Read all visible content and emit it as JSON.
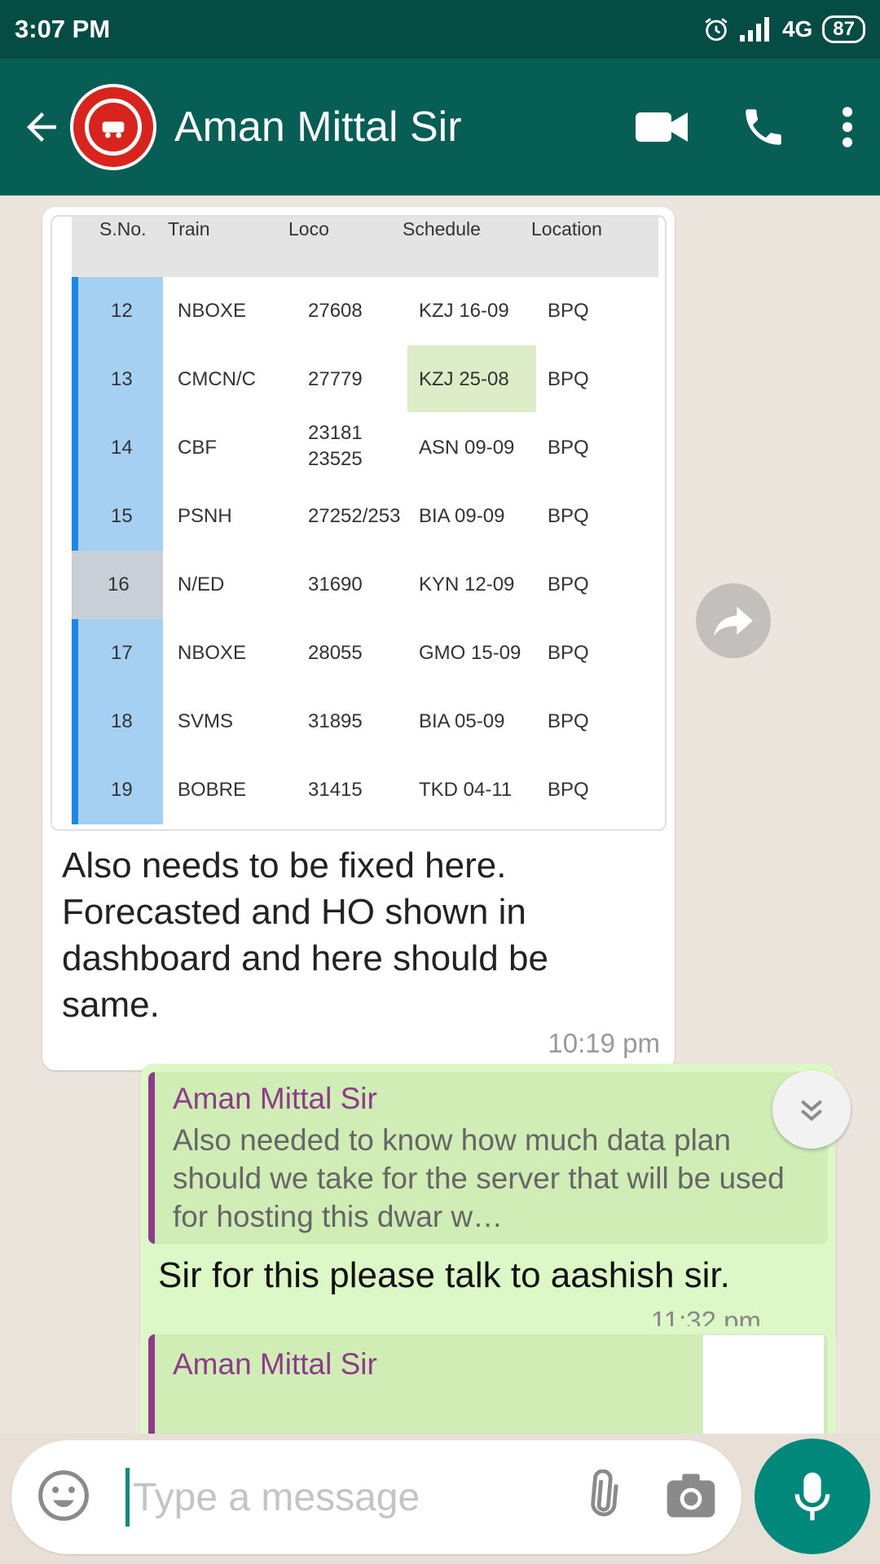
{
  "status_bar": {
    "time": "3:07 PM",
    "network": "4G",
    "battery": "87"
  },
  "header": {
    "contact_name": "Aman Mittal Sir"
  },
  "table": {
    "headers": [
      "S.No.",
      "Train",
      "Loco",
      "Schedule",
      "Location"
    ],
    "rows": [
      {
        "sno": "12",
        "train": "NBOXE",
        "loco": "27608",
        "schedule": "KZJ 16-09",
        "location": "BPQ"
      },
      {
        "sno": "13",
        "train": "CMCN/C",
        "loco": "27779",
        "schedule": "KZJ 25-08",
        "location": "BPQ"
      },
      {
        "sno": "14",
        "train": "CBF",
        "loco": "23181",
        "loco2": "23525",
        "schedule": "ASN 09-09",
        "location": "BPQ"
      },
      {
        "sno": "15",
        "train": "PSNH",
        "loco": "27252/253",
        "schedule": "BIA 09-09",
        "location": "BPQ"
      },
      {
        "sno": "16",
        "train": "N/ED",
        "loco": "31690",
        "schedule": "KYN 12-09",
        "location": "BPQ"
      },
      {
        "sno": "17",
        "train": "NBOXE",
        "loco": "28055",
        "schedule": "GMO 15-09",
        "location": "BPQ"
      },
      {
        "sno": "18",
        "train": "SVMS",
        "loco": "31895",
        "schedule": "BIA 05-09",
        "location": "BPQ"
      },
      {
        "sno": "19",
        "train": "BOBRE",
        "loco": "31415",
        "schedule": "TKD 04-11",
        "location": "BPQ"
      }
    ]
  },
  "messages": {
    "incoming_text": "Also needs to be fixed here. Forecasted and HO shown in dashboard and here should be same.",
    "incoming_time": "10:19 pm",
    "reply_quote_name": "Aman Mittal Sir",
    "reply_quote_text": "Also needed to know how much data plan should we take for the server that will be used for hosting this dwar w…",
    "outgoing_text": "Sir for this please talk to aashish sir.",
    "outgoing_time": "11:32 pm",
    "next_quote_name": "Aman Mittal Sir"
  },
  "input": {
    "placeholder": "Type a message"
  },
  "icons": [
    "back-arrow-icon",
    "video-call-icon",
    "voice-call-icon",
    "more-options-icon",
    "forward-icon",
    "scroll-down-icon",
    "emoji-icon",
    "attach-icon",
    "camera-icon",
    "mic-icon",
    "alarm-icon",
    "signal-icon"
  ],
  "colors": {
    "header": "#075e54",
    "status_bar": "#054d44",
    "outgoing_bubble": "#dcf8c6",
    "quote_accent": "#8e3b8c",
    "mic_button": "#00897b"
  }
}
